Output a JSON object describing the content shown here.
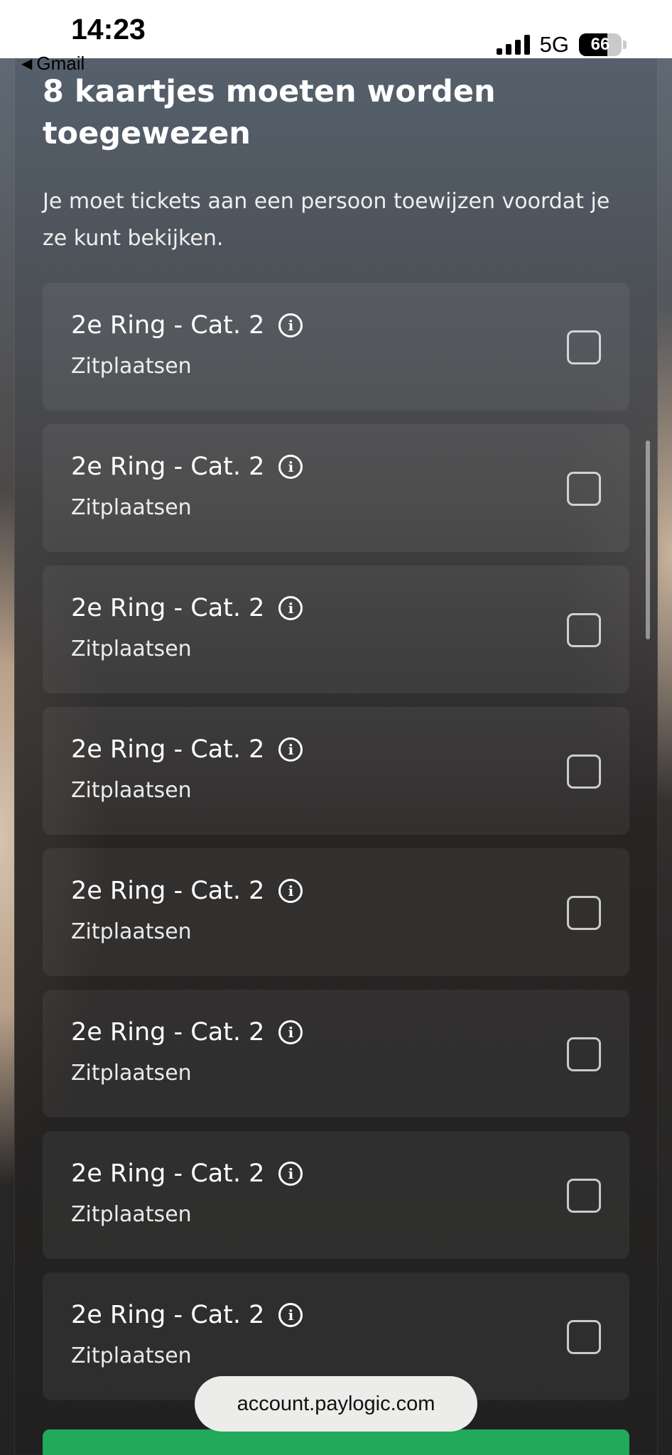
{
  "status_bar": {
    "time": "14:23",
    "back_app": "Gmail",
    "network": "5G",
    "battery_percent": "66",
    "battery_level": 0.66
  },
  "modal": {
    "title": "8 kaartjes moeten worden toegewezen",
    "subtitle": "Je moet tickets aan een persoon toewijzen voordat je ze kunt bekijken."
  },
  "tickets": [
    {
      "name": "2e Ring - Cat. 2",
      "type": "Zitplaatsen",
      "checked": false
    },
    {
      "name": "2e Ring - Cat. 2",
      "type": "Zitplaatsen",
      "checked": false
    },
    {
      "name": "2e Ring - Cat. 2",
      "type": "Zitplaatsen",
      "checked": false
    },
    {
      "name": "2e Ring - Cat. 2",
      "type": "Zitplaatsen",
      "checked": false
    },
    {
      "name": "2e Ring - Cat. 2",
      "type": "Zitplaatsen",
      "checked": false
    },
    {
      "name": "2e Ring - Cat. 2",
      "type": "Zitplaatsen",
      "checked": false
    },
    {
      "name": "2e Ring - Cat. 2",
      "type": "Zitplaatsen",
      "checked": false
    },
    {
      "name": "2e Ring - Cat. 2",
      "type": "Zitplaatsen",
      "checked": false
    }
  ],
  "browser": {
    "url": "account.paylogic.com"
  },
  "colors": {
    "primary_button": "#22a95a",
    "panel": "#3a3a3b"
  },
  "icons": {
    "info": "info-icon",
    "back": "back-triangle-icon"
  }
}
